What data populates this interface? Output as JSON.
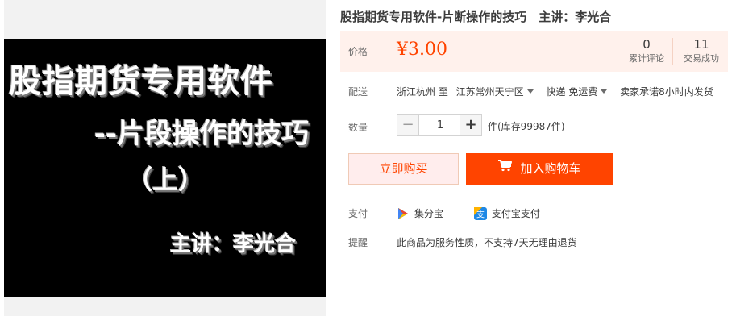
{
  "product_image": {
    "line1": "股指期货专用软件",
    "line2": "--片段操作的技巧",
    "line3": "（上）",
    "line4": "主讲：李光合"
  },
  "title": "股指期货专用软件-片断操作的技巧　主讲：李光合",
  "price": {
    "label": "价格",
    "value": "¥3.00"
  },
  "stats": {
    "reviews_count": "0",
    "reviews_label": "累计评论",
    "deals_count": "11",
    "deals_label": "交易成功"
  },
  "delivery": {
    "label": "配送",
    "from": "浙江杭州 至",
    "to": "江苏常州天宁区",
    "method": "快递 免运费",
    "promise": "卖家承诺8小时内发货"
  },
  "quantity": {
    "label": "数量",
    "value": "1",
    "minus": "−",
    "plus": "+",
    "stock": "件(库存99987件)"
  },
  "buttons": {
    "buy_now": "立即购买",
    "add_to_cart": "加入购物车"
  },
  "payment": {
    "label": "支付",
    "option1": "集分宝",
    "option2": "支付宝支付"
  },
  "reminder": {
    "label": "提醒",
    "text": "此商品为服务性质，不支持7天无理由退货"
  },
  "colors": {
    "accent": "#ff4400",
    "price_bg": "#fff1ec",
    "buy_now_bg": "#ffeded"
  },
  "icons": {
    "cart": "shopping-cart-icon",
    "jifenbao": "jifenbao-icon",
    "alipay": "alipay-icon",
    "dropdown": "chevron-down-icon"
  }
}
